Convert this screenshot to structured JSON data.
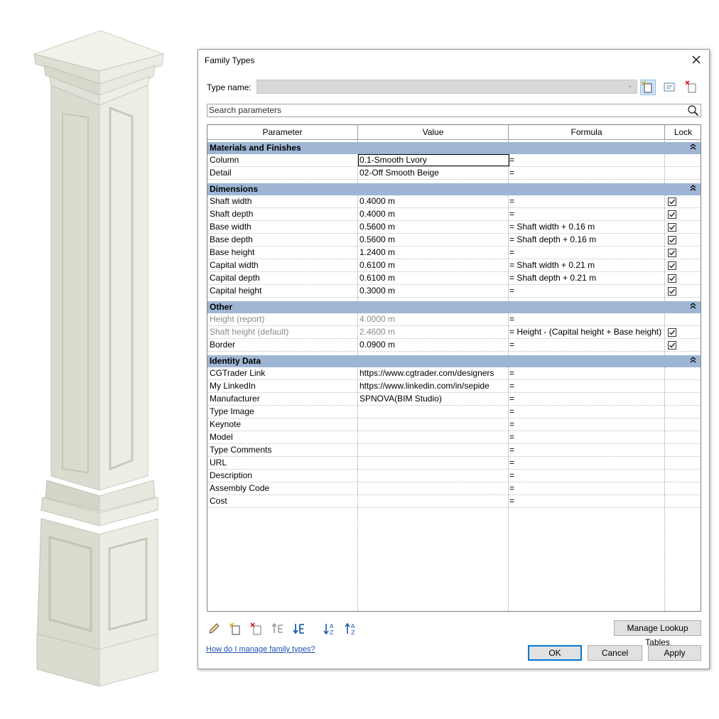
{
  "dialog": {
    "title": "Family Types",
    "type_name_label": "Type name:",
    "type_name_value": "",
    "search_placeholder": "Search parameters",
    "help_link": "How do I manage family types?",
    "buttons": {
      "manage_lookup": "Manage Lookup Tables",
      "ok": "OK",
      "cancel": "Cancel",
      "apply": "Apply"
    }
  },
  "table": {
    "headers": {
      "parameter": "Parameter",
      "value": "Value",
      "formula": "Formula",
      "lock": "Lock"
    },
    "groups": [
      {
        "name": "Materials and Finishes",
        "rows": [
          {
            "param": "Column",
            "value": "0.1-Smooth Lvory",
            "formula": "=",
            "lock": null,
            "greyed": false,
            "selected": true
          },
          {
            "param": "Detail",
            "value": "02-Off Smooth Beige",
            "formula": "=",
            "lock": null,
            "greyed": false
          }
        ]
      },
      {
        "name": "Dimensions",
        "rows": [
          {
            "param": "Shaft width",
            "value": "0.4000 m",
            "formula": "=",
            "lock": true
          },
          {
            "param": "Shaft depth",
            "value": "0.4000 m",
            "formula": "=",
            "lock": true
          },
          {
            "param": "Base width",
            "value": "0.5600 m",
            "formula": "= Shaft width + 0.16 m",
            "lock": true
          },
          {
            "param": "Base depth",
            "value": "0.5600 m",
            "formula": "= Shaft depth + 0.16 m",
            "lock": true
          },
          {
            "param": "Base height",
            "value": "1.2400 m",
            "formula": "=",
            "lock": true
          },
          {
            "param": "Capital width",
            "value": "0.6100 m",
            "formula": "= Shaft width + 0.21 m",
            "lock": true
          },
          {
            "param": "Capital depth",
            "value": "0.6100 m",
            "formula": "= Shaft depth + 0.21 m",
            "lock": true
          },
          {
            "param": "Capital height",
            "value": "0.3000 m",
            "formula": "=",
            "lock": true
          }
        ]
      },
      {
        "name": "Other",
        "rows": [
          {
            "param": "Height (report)",
            "value": "4.0000 m",
            "formula": "=",
            "lock": null,
            "greyed": true
          },
          {
            "param": "Shaft height (default)",
            "value": "2.4600 m",
            "formula": "= Height - (Capital height + Base height)",
            "lock": true,
            "greyed": true
          },
          {
            "param": "Border",
            "value": "0.0900 m",
            "formula": "=",
            "lock": true
          }
        ]
      },
      {
        "name": "Identity Data",
        "rows": [
          {
            "param": "CGTrader Link",
            "value": "https://www.cgtrader.com/designers",
            "formula": "=",
            "lock": null
          },
          {
            "param": "My LinkedIn",
            "value": "https://www.linkedin.com/in/sepide",
            "formula": "=",
            "lock": null
          },
          {
            "param": "Manufacturer",
            "value": "SPNOVA(BIM Studio)",
            "formula": "=",
            "lock": null
          },
          {
            "param": "Type Image",
            "value": "",
            "formula": "=",
            "lock": null
          },
          {
            "param": "Keynote",
            "value": "",
            "formula": "=",
            "lock": null
          },
          {
            "param": "Model",
            "value": "",
            "formula": "=",
            "lock": null
          },
          {
            "param": "Type Comments",
            "value": "",
            "formula": "=",
            "lock": null
          },
          {
            "param": "URL",
            "value": "",
            "formula": "=",
            "lock": null
          },
          {
            "param": "Description",
            "value": "",
            "formula": "=",
            "lock": null
          },
          {
            "param": "Assembly Code",
            "value": "",
            "formula": "=",
            "lock": null
          },
          {
            "param": "Cost",
            "value": "",
            "formula": "=",
            "lock": null
          }
        ]
      }
    ]
  },
  "colors": {
    "group_header": "#9eb6d4",
    "link": "#1f4fb8",
    "ok_border": "#0078d7",
    "pillar": "#e9ebe0"
  }
}
